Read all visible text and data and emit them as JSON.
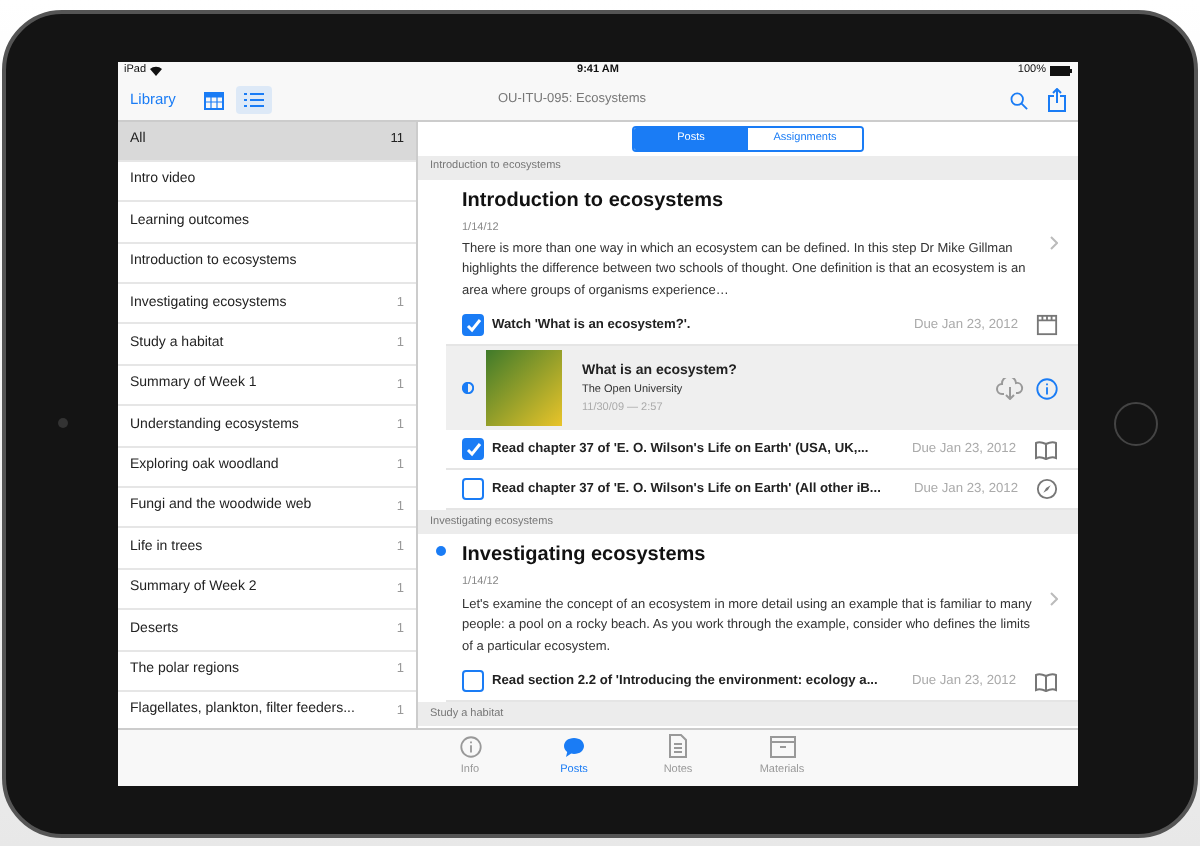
{
  "status_bar": {
    "device": "iPad",
    "time": "9:41 AM",
    "battery": "100%"
  },
  "nav_bar": {
    "back": "Library",
    "title": "OU-ITU-095: Ecosystems",
    "views": [
      {
        "kind": "calendar",
        "selected": false
      },
      {
        "kind": "list",
        "selected": true
      }
    ]
  },
  "sidebar": {
    "items": [
      {
        "label": "All",
        "count": "11",
        "selected": true
      },
      {
        "label": "Intro video",
        "selected": false
      },
      {
        "label": "Learning outcomes",
        "selected": false
      },
      {
        "label": "Introduction to ecosystems",
        "selected": false
      },
      {
        "label": "Investigating ecosystems",
        "count": "1",
        "selected": false
      },
      {
        "label": "Study a habitat",
        "count": "1",
        "selected": false
      },
      {
        "label": "Summary of Week 1",
        "count": "1",
        "selected": false
      },
      {
        "label": "Understanding ecosystems",
        "count": "1",
        "selected": false
      },
      {
        "label": "Exploring oak woodland",
        "count": "1",
        "selected": false
      },
      {
        "label": "Fungi and the woodwide web",
        "count": "1",
        "selected": false
      },
      {
        "label": "Life in trees",
        "count": "1",
        "selected": false
      },
      {
        "label": "Summary of Week 2",
        "count": "1",
        "selected": false
      },
      {
        "label": "Deserts",
        "count": "1",
        "selected": false
      },
      {
        "label": "The polar regions",
        "count": "1",
        "selected": false
      },
      {
        "label": "Flagellates, plankton, filter feeders...",
        "count": "1",
        "selected": false
      }
    ]
  },
  "segments": [
    {
      "label": "Posts",
      "selected": true
    },
    {
      "label": "Assignments",
      "selected": false
    }
  ],
  "posts": [
    {
      "section": "Introduction to ecosystems",
      "title": "Introduction to ecosystems",
      "date": "1/14/12",
      "unread": false,
      "body": "There is more than one way in which an ecosystem can be defined. In this step Dr Mike Gillman highlights the difference between two schools of thought. One definition is that an ecosystem is an area where groups of organisms experience…",
      "items": [
        {
          "kind": "video",
          "label": "Watch 'What is an ecosystem?'.",
          "due": "Due Jan 23, 2012",
          "checked": true
        },
        {
          "kind": "media",
          "title": "What is an ecosystem?",
          "publisher": "The Open University",
          "meta": "11/30/09 — 2:57"
        },
        {
          "kind": "book",
          "label": "Read chapter 37 of 'E. O. Wilson's Life on Earth' (USA, UK,...",
          "due": "Due Jan 23, 2012",
          "checked": true
        },
        {
          "kind": "link",
          "label": "Read chapter 37 of 'E. O. Wilson's Life on Earth' (All other iB...",
          "due": "Due Jan 23, 2012",
          "checked": false
        }
      ]
    },
    {
      "section": "Investigating ecosystems",
      "title": "Investigating ecosystems",
      "date": "1/14/12",
      "unread": true,
      "body": "Let's examine the concept of an ecosystem in more detail using an example that is familiar to many people: a pool on a rocky beach. As you work through the example, consider who defines the limits of a particular ecosystem.",
      "items": [
        {
          "kind": "book",
          "label": "Read section 2.2 of 'Introducing the environment: ecology a...",
          "due": "Due Jan 23, 2012",
          "checked": false
        }
      ]
    },
    {
      "section": "Study a habitat"
    }
  ],
  "tab_bar": [
    {
      "kind": "info",
      "label": "Info",
      "selected": false
    },
    {
      "kind": "posts",
      "label": "Posts",
      "selected": true
    },
    {
      "kind": "notes",
      "label": "Notes",
      "selected": false
    },
    {
      "kind": "materials",
      "label": "Materials",
      "selected": false
    }
  ]
}
